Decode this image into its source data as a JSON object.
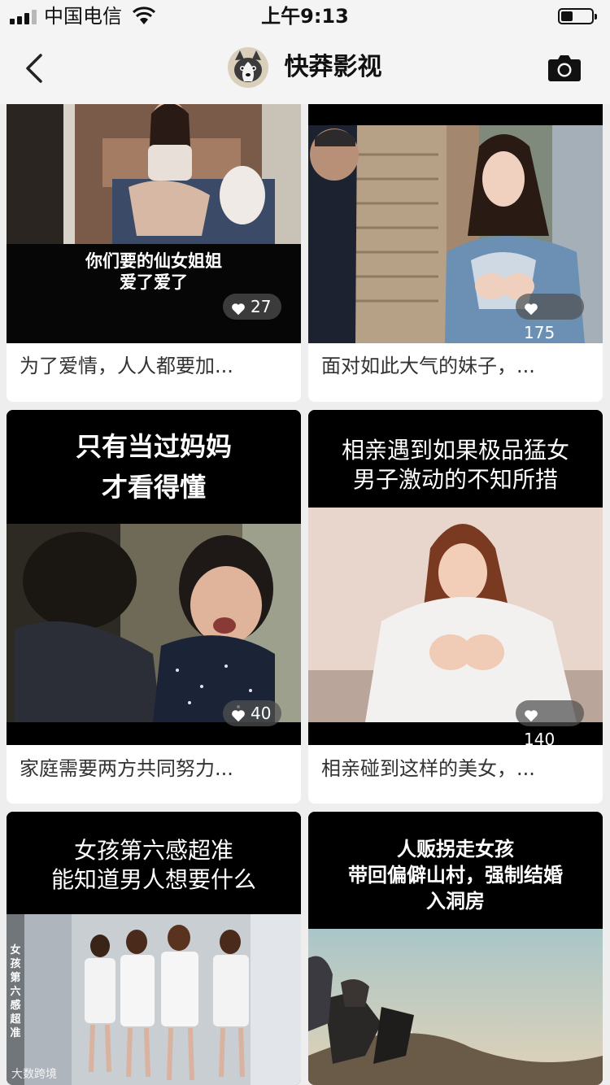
{
  "status_bar": {
    "carrier": "中国电信",
    "time": "上午9:13"
  },
  "nav": {
    "title": "快莽影视",
    "back_icon": "chevron-left-icon",
    "camera_icon": "camera-icon"
  },
  "cards": [
    {
      "overlay": "你们要的仙女姐姐\n爱了爱了",
      "likes": "27",
      "caption": "为了爱情，人人都要加..."
    },
    {
      "overlay": "",
      "likes": "175",
      "caption": "面对如此大气的妹子，..."
    },
    {
      "overlay": "只有当过妈妈\n才看得懂",
      "likes": "40",
      "caption": "家庭需要两方共同努力..."
    },
    {
      "overlay": "相亲遇到如果极品猛女\n男子激动的不知所措",
      "likes": "140",
      "caption": "相亲碰到这样的美女，..."
    },
    {
      "overlay": "女孩第六感超准\n能知道男人想要什么",
      "side_text": "女孩第六感超准",
      "watermark": "大数跨境"
    },
    {
      "overlay": "人贩拐走女孩\n带回偏僻山村，强制结婚\n入洞房"
    }
  ]
}
